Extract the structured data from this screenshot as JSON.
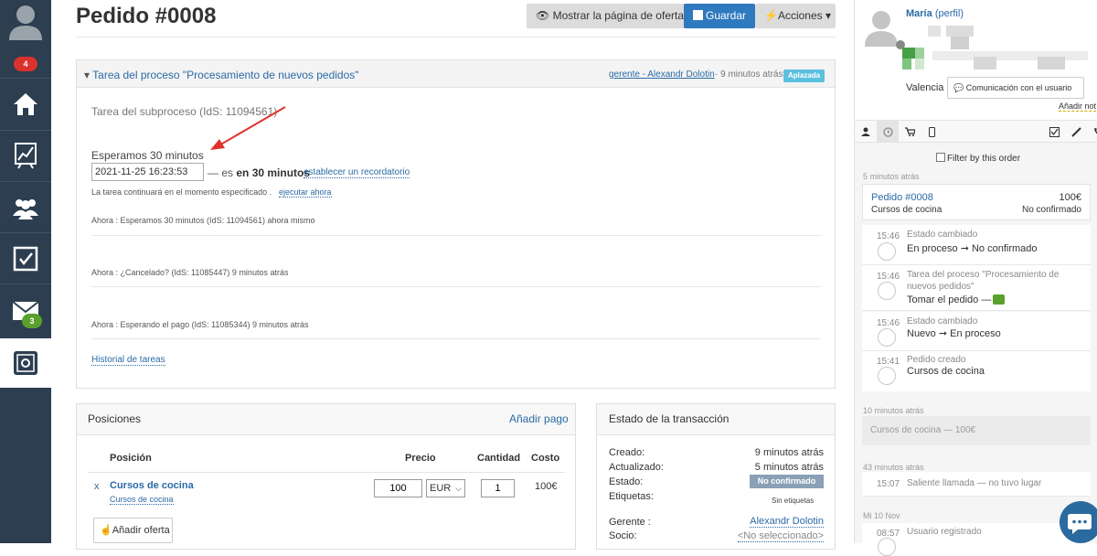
{
  "sidebar": {
    "notifications_badge": "4",
    "mail_badge": "3",
    "items": [
      "home-icon",
      "chart-icon",
      "users-icon",
      "tasks-icon",
      "mail-icon",
      "settings-icon"
    ]
  },
  "header": {
    "title": "Pedido #0008",
    "show_offers_label": "Mostrar la página de ofertas",
    "save_label": "Guardar",
    "actions_label": "Acciones"
  },
  "task": {
    "title": "Tarea del proceso \"Procesamiento de nuevos pedidos\"",
    "assignee": "gerente - Alexandr Dolotin",
    "time": "· 9 minutos atrás",
    "status": "Aplazada",
    "subprocess": "Tarea del subproceso (IdS: 11094561)",
    "waiting_label": "Esperamos 30 minutos",
    "datetime_value": "2021-11-25 16:23:53",
    "suffix_prefix": "— es",
    "suffix_bold": "en 30 minutos",
    "reminder_link": "establecer un recordatorio",
    "continue_text": "La tarea continuará en el momento especificado .",
    "execute_link": "ejecutar ahora",
    "history": [
      "Ahora : Esperamos 30 minutos (IdS: 11094561) ahora mismo",
      "Ahora : ¿Cancelado? (IdS: 11085447) 9 minutos atrás",
      "Ahora : Esperando el pago (IdS: 11085344) 9 minutos atrás"
    ],
    "history_link": "Historial de tareas"
  },
  "positions": {
    "title": "Posiciones",
    "add_payment": "Añadir pago",
    "columns": [
      "Posición",
      "Precio",
      "Cantidad",
      "Costo"
    ],
    "row": {
      "remove": "x",
      "name": "Cursos de cocina",
      "sub": "Cursos de cocina",
      "price": "100",
      "currency": "EUR",
      "qty": "1",
      "cost": "100€"
    },
    "add_offer": "Añadir oferta"
  },
  "transaction": {
    "title": "Estado de la transacción",
    "created_label": "Creado:",
    "created_value": "9 minutos atrás",
    "updated_label": "Actualizado:",
    "updated_value": "5 minutos atrás",
    "state_label": "Estado:",
    "state_value": "No confirmado",
    "tags_label": "Etiquetas:",
    "tags_value": "Sin etiquetas",
    "manager_label": "Gerente :",
    "manager_value": "Alexandr Dolotin",
    "partner_label": "Socio:",
    "partner_value": "<No seleccionado>"
  },
  "customer": {
    "name": "María",
    "profile": "(perfil)",
    "city": "Valencia",
    "communicate": "Comunicación con el usuario",
    "add_note": "Añadir not"
  },
  "feed": {
    "filter_label": "Filter by this order",
    "group1": "5 minutos atrás",
    "order_card": {
      "title": "Pedido #0008",
      "amount": "100€",
      "product": "Cursos de cocina",
      "status": "No confirmado"
    },
    "events": [
      {
        "time": "15:46",
        "t1": "Estado cambiado",
        "t2": "En proceso ➞ No confirmado"
      },
      {
        "time": "15:46",
        "t1": "Tarea del proceso \"Procesamiento de",
        "t1b": "nuevos pedidos\"",
        "t2": "Tomar el pedido —"
      },
      {
        "time": "15:46",
        "t1": "Estado cambiado",
        "t2": "Nuevo ➞ En proceso"
      },
      {
        "time": "15:41",
        "t1": "Pedido creado",
        "t2": "Cursos de cocina"
      }
    ],
    "group2": "10 minutos atrás",
    "past_order": "Cursos de cocina — 100€",
    "group3": "43 minutos atrás",
    "call": {
      "time": "15:07",
      "text": "Saliente llamada — no tuvo lugar"
    },
    "group4": "Mi 10 Nov",
    "registered": {
      "time": "08:57",
      "text": "Usuario registrado"
    }
  },
  "colors": {
    "sidebar": "#2c3e50",
    "primary": "#2f79bf",
    "danger": "#d9322f",
    "success": "#5aa02c",
    "status_badge": "#5bc0de",
    "state_badge": "#8aa0b6"
  }
}
